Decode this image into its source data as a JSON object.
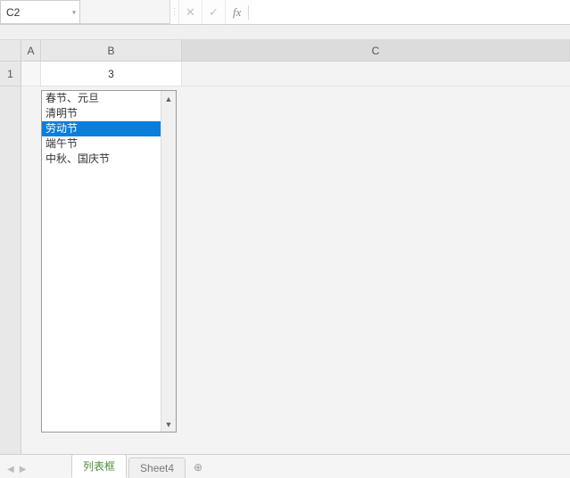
{
  "name_box": {
    "value": "C2"
  },
  "formula_bar": {
    "fx_label": "fx",
    "value": ""
  },
  "columns": {
    "A": "A",
    "B": "B",
    "C": "C"
  },
  "rows": {
    "r1": "1"
  },
  "cell_B1": "3",
  "listbox": {
    "items": [
      {
        "label": "春节、元旦",
        "selected": false
      },
      {
        "label": "清明节",
        "selected": false
      },
      {
        "label": "劳动节",
        "selected": true
      },
      {
        "label": "端午节",
        "selected": false
      },
      {
        "label": "中秋、国庆节",
        "selected": false
      }
    ]
  },
  "tabs": {
    "active": "列表框",
    "other": "Sheet4",
    "add_icon": "⊕"
  },
  "icons": {
    "dropdown": "▾",
    "sep": "⋮",
    "cancel": "✕",
    "confirm": "✓",
    "up": "▲",
    "down": "▼",
    "nav_prev": "◀",
    "nav_next": "▶"
  }
}
